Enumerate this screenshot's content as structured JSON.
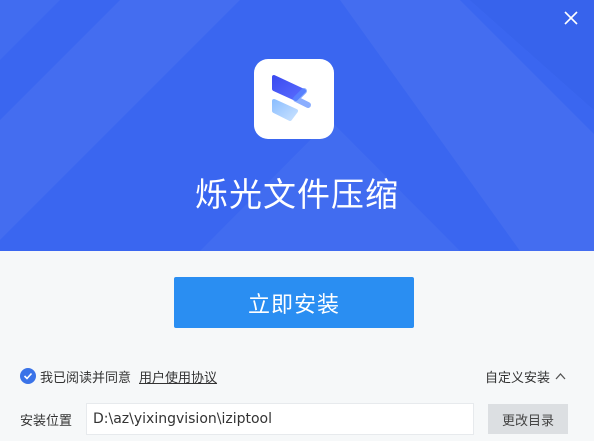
{
  "app": {
    "title": "烁光文件压缩"
  },
  "header": {
    "close_icon": "close-icon",
    "logo_icon": "chevrons-logo-icon"
  },
  "main": {
    "install_button_label": "立即安装"
  },
  "agreement": {
    "checked": true,
    "text": "我已阅读并同意",
    "link_text": "用户使用协议"
  },
  "custom_install": {
    "label": "自定义安装",
    "icon": "chevron-up-icon"
  },
  "install_path": {
    "label": "安装位置",
    "value": "D:\\az\\yixingvision\\iziptool",
    "change_button_label": "更改目录"
  },
  "colors": {
    "header_bg": "#3a66f0",
    "primary_button": "#2a8ef2",
    "checkbox": "#3a73e8",
    "page_bg": "#f6f8f9"
  }
}
